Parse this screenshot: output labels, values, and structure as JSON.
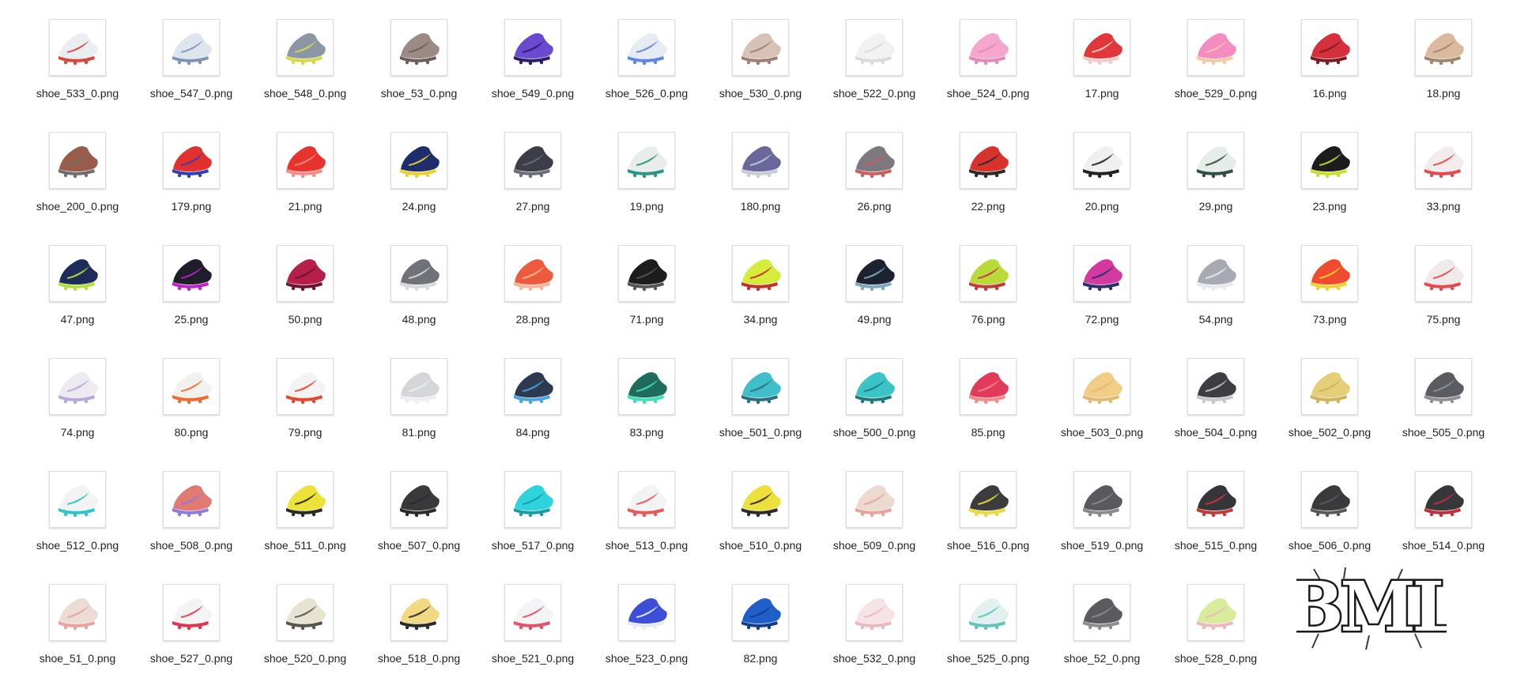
{
  "files": [
    {
      "name": "shoe_533_0.png",
      "c1": "#e9eef2",
      "c2": "#d9453f"
    },
    {
      "name": "shoe_547_0.png",
      "c1": "#dfe5ee",
      "c2": "#7f93b2"
    },
    {
      "name": "shoe_548_0.png",
      "c1": "#8c97a6",
      "c2": "#d7d94b"
    },
    {
      "name": "shoe_53_0.png",
      "c1": "#9e8a85",
      "c2": "#6b5c57"
    },
    {
      "name": "shoe_549_0.png",
      "c1": "#6a4bd0",
      "c2": "#2a1d66"
    },
    {
      "name": "shoe_526_0.png",
      "c1": "#e6ecf2",
      "c2": "#5f86e6"
    },
    {
      "name": "shoe_530_0.png",
      "c1": "#d8c2b5",
      "c2": "#9e7f76"
    },
    {
      "name": "shoe_522_0.png",
      "c1": "#f2f2f2",
      "c2": "#dadada"
    },
    {
      "name": "shoe_524_0.png",
      "c1": "#f4a6cc",
      "c2": "#e588b6"
    },
    {
      "name": "17.png",
      "c1": "#e0383a",
      "c2": "#f4c9c9"
    },
    {
      "name": "shoe_529_0.png",
      "c1": "#f58bc0",
      "c2": "#f4c8a5"
    },
    {
      "name": "16.png",
      "c1": "#d6303c",
      "c2": "#7a1c24"
    },
    {
      "name": "18.png",
      "c1": "#d9b9a0",
      "c2": "#a0876f"
    },
    {
      "name": "shoe_200_0.png",
      "c1": "#9a5c4a",
      "c2": "#6d6d6d"
    },
    {
      "name": "179.png",
      "c1": "#e0312f",
      "c2": "#2f3fb5"
    },
    {
      "name": "21.png",
      "c1": "#e8322e",
      "c2": "#f38d87"
    },
    {
      "name": "24.png",
      "c1": "#1e2d6b",
      "c2": "#e8d12e"
    },
    {
      "name": "27.png",
      "c1": "#3c3d48",
      "c2": "#6a6c78"
    },
    {
      "name": "19.png",
      "c1": "#e8ecea",
      "c2": "#2a9580"
    },
    {
      "name": "180.png",
      "c1": "#6a679a",
      "c2": "#c9c9da"
    },
    {
      "name": "26.png",
      "c1": "#7d7780",
      "c2": "#cf5b5b"
    },
    {
      "name": "22.png",
      "c1": "#d8322c",
      "c2": "#2a2a2a"
    },
    {
      "name": "20.png",
      "c1": "#f0f0f0",
      "c2": "#222222"
    },
    {
      "name": "29.png",
      "c1": "#e6ede9",
      "c2": "#2f4f46"
    },
    {
      "name": "23.png",
      "c1": "#1c1c1c",
      "c2": "#c8df2e"
    },
    {
      "name": "33.png",
      "c1": "#f2ecec",
      "c2": "#e5494f"
    },
    {
      "name": "47.png",
      "c1": "#1f2c5a",
      "c2": "#b4e03a"
    },
    {
      "name": "25.png",
      "c1": "#1e1e2a",
      "c2": "#c021c9"
    },
    {
      "name": "50.png",
      "c1": "#b51f4a",
      "c2": "#6a1431"
    },
    {
      "name": "48.png",
      "c1": "#6f7278",
      "c2": "#d7d9dd"
    },
    {
      "name": "28.png",
      "c1": "#ec5b3d",
      "c2": "#f8b59b"
    },
    {
      "name": "71.png",
      "c1": "#1d1d1f",
      "c2": "#555555"
    },
    {
      "name": "34.png",
      "c1": "#d5ec3c",
      "c2": "#c22f2f"
    },
    {
      "name": "49.png",
      "c1": "#1c2230",
      "c2": "#7fa8c0"
    },
    {
      "name": "76.png",
      "c1": "#b8db3a",
      "c2": "#c33a3a"
    },
    {
      "name": "72.png",
      "c1": "#d33aa0",
      "c2": "#2d2f6b"
    },
    {
      "name": "54.png",
      "c1": "#a7a9b3",
      "c2": "#e8e8ef"
    },
    {
      "name": "73.png",
      "c1": "#ef4b2f",
      "c2": "#f4d12e"
    },
    {
      "name": "75.png",
      "c1": "#f0eaea",
      "c2": "#e5494f"
    },
    {
      "name": "74.png",
      "c1": "#eeeaf2",
      "c2": "#b9a7d9"
    },
    {
      "name": "80.png",
      "c1": "#f1f1ee",
      "c2": "#ef6a2e"
    },
    {
      "name": "79.png",
      "c1": "#f3f3f3",
      "c2": "#e5472f"
    },
    {
      "name": "81.png",
      "c1": "#d4d6da",
      "c2": "#eeeeee"
    },
    {
      "name": "84.png",
      "c1": "#2e3a52",
      "c2": "#4aa6e0"
    },
    {
      "name": "83.png",
      "c1": "#1f6b5c",
      "c2": "#42e0b8"
    },
    {
      "name": "shoe_501_0.png",
      "c1": "#3fbfc9",
      "c2": "#2b6f7a"
    },
    {
      "name": "shoe_500_0.png",
      "c1": "#3ac4c8",
      "c2": "#1f7a80"
    },
    {
      "name": "85.png",
      "c1": "#e13a5a",
      "c2": "#f48a8a"
    },
    {
      "name": "shoe_503_0.png",
      "c1": "#f1cd88",
      "c2": "#e4b870"
    },
    {
      "name": "shoe_504_0.png",
      "c1": "#3d3d42",
      "c2": "#c6c6cc"
    },
    {
      "name": "shoe_502_0.png",
      "c1": "#e5ce78",
      "c2": "#cdb45c"
    },
    {
      "name": "shoe_505_0.png",
      "c1": "#5a5c62",
      "c2": "#8e9096"
    },
    {
      "name": "shoe_512_0.png",
      "c1": "#f3f3f3",
      "c2": "#2fc4c8"
    },
    {
      "name": "shoe_508_0.png",
      "c1": "#e07a73",
      "c2": "#8e7ad9"
    },
    {
      "name": "shoe_511_0.png",
      "c1": "#ece23a",
      "c2": "#2a2a2a"
    },
    {
      "name": "shoe_507_0.png",
      "c1": "#3a3a3d",
      "c2": "#2a2a2b"
    },
    {
      "name": "shoe_517_0.png",
      "c1": "#2fd3db",
      "c2": "#1a9ca3"
    },
    {
      "name": "shoe_513_0.png",
      "c1": "#f1f3f4",
      "c2": "#e7585c"
    },
    {
      "name": "shoe_510_0.png",
      "c1": "#eee03c",
      "c2": "#2b2b2b"
    },
    {
      "name": "shoe_509_0.png",
      "c1": "#ecd9cf",
      "c2": "#e7a49a"
    },
    {
      "name": "shoe_516_0.png",
      "c1": "#3c3c3f",
      "c2": "#e8d934"
    },
    {
      "name": "shoe_519_0.png",
      "c1": "#5a5a5e",
      "c2": "#8a8a8e"
    },
    {
      "name": "shoe_515_0.png",
      "c1": "#35353a",
      "c2": "#c23a3a"
    },
    {
      "name": "shoe_506_0.png",
      "c1": "#3a3a3d",
      "c2": "#59595d"
    },
    {
      "name": "shoe_514_0.png",
      "c1": "#37373b",
      "c2": "#c22f3a"
    },
    {
      "name": "shoe_51_0.png",
      "c1": "#ecdcd6",
      "c2": "#e8a39a"
    },
    {
      "name": "shoe_527_0.png",
      "c1": "#f4f4f4",
      "c2": "#e5334f"
    },
    {
      "name": "shoe_520_0.png",
      "c1": "#e8e2d2",
      "c2": "#5a5548"
    },
    {
      "name": "shoe_518_0.png",
      "c1": "#f1d882",
      "c2": "#2a2a2a"
    },
    {
      "name": "shoe_521_0.png",
      "c1": "#f4f4f6",
      "c2": "#e5506a"
    },
    {
      "name": "shoe_523_0.png",
      "c1": "#3c4fd6",
      "c2": "#e8eaf2"
    },
    {
      "name": "82.png",
      "c1": "#1e5fc9",
      "c2": "#123f8a"
    },
    {
      "name": "shoe_532_0.png",
      "c1": "#f6e3e6",
      "c2": "#e9b9c0"
    },
    {
      "name": "shoe_525_0.png",
      "c1": "#e2f0ef",
      "c2": "#5fc6b9"
    },
    {
      "name": "shoe_52_0.png",
      "c1": "#5b5b5f",
      "c2": "#8c8c90"
    },
    {
      "name": "shoe_528_0.png",
      "c1": "#d9ec9c",
      "c2": "#eeb7c0"
    }
  ],
  "logo": {
    "text": "BML",
    "color": "#1a1a1a"
  }
}
